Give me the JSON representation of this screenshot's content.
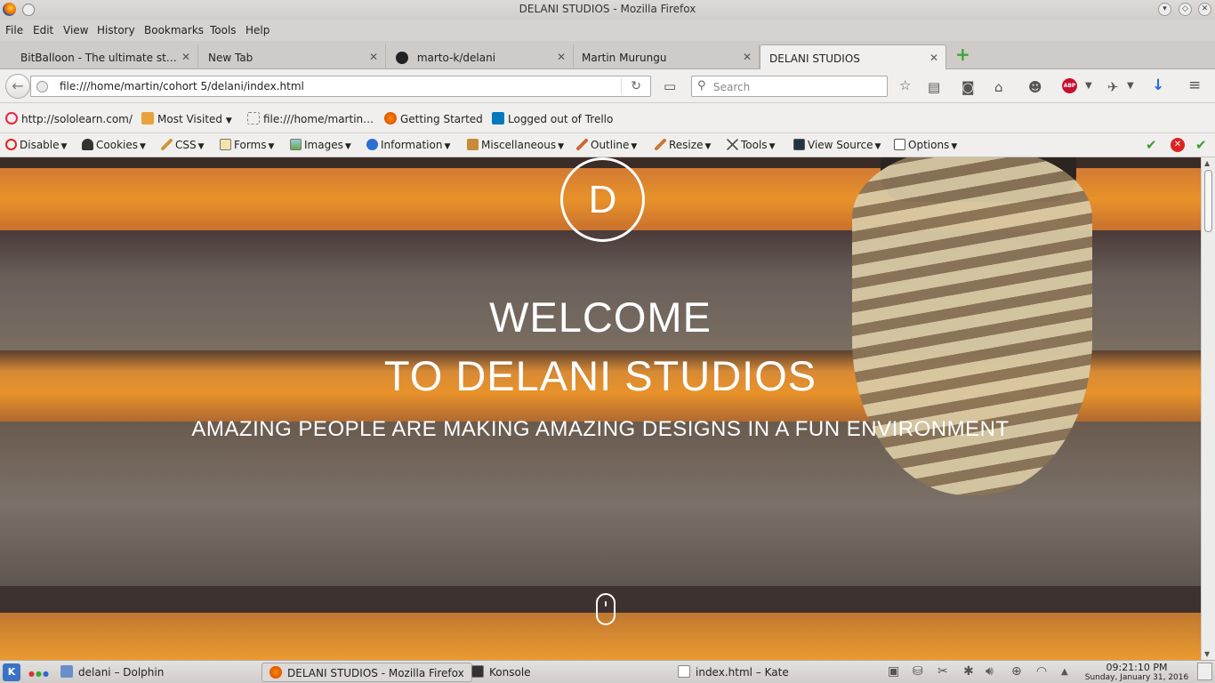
{
  "window": {
    "title": "DELANI STUDIOS - Mozilla Firefox"
  },
  "menu": [
    "File",
    "Edit",
    "View",
    "History",
    "Bookmarks",
    "Tools",
    "Help"
  ],
  "tabs": [
    {
      "label": "BitBalloon - The ultimate st…",
      "active": false
    },
    {
      "label": "New Tab",
      "active": false
    },
    {
      "label": "marto-k/delani",
      "active": false
    },
    {
      "label": "Martin Murungu",
      "active": false
    },
    {
      "label": "DELANI STUDIOS",
      "active": true
    }
  ],
  "nav": {
    "url": "file:///home/martin/cohort 5/delani/index.html",
    "search_placeholder": "Search",
    "abp": "ABP"
  },
  "bookmarks": [
    "http://sololearn.com/",
    "Most Visited",
    "file:///home/martin…",
    "Getting Started",
    "Logged out of Trello"
  ],
  "devtools": [
    "Disable",
    "Cookies",
    "CSS",
    "Forms",
    "Images",
    "Information",
    "Miscellaneous",
    "Outline",
    "Resize",
    "Tools",
    "View Source",
    "Options"
  ],
  "hero": {
    "logo_letter": "D",
    "heading_line1": "WELCOME",
    "heading_line2": "TO DELANI STUDIOS",
    "tagline": "AMAZING PEOPLE ARE MAKING AMAZING DESIGNS IN A FUN ENVIRONMENT"
  },
  "taskbar": {
    "start": "K",
    "items": [
      {
        "label": "delani – Dolphin",
        "active": false
      },
      {
        "label": "DELANI STUDIOS - Mozilla Firefox",
        "active": true
      },
      {
        "label": "Konsole",
        "active": false
      },
      {
        "label": "index.html – Kate",
        "active": false
      }
    ],
    "time": "09:21:10 PM",
    "date": "Sunday, January 31, 2016"
  },
  "colors": {
    "hero_orange": "#e8922a",
    "hero_dark": "#4a3a34",
    "abp_red": "#c8102e",
    "accent_green": "#3aa53a"
  }
}
